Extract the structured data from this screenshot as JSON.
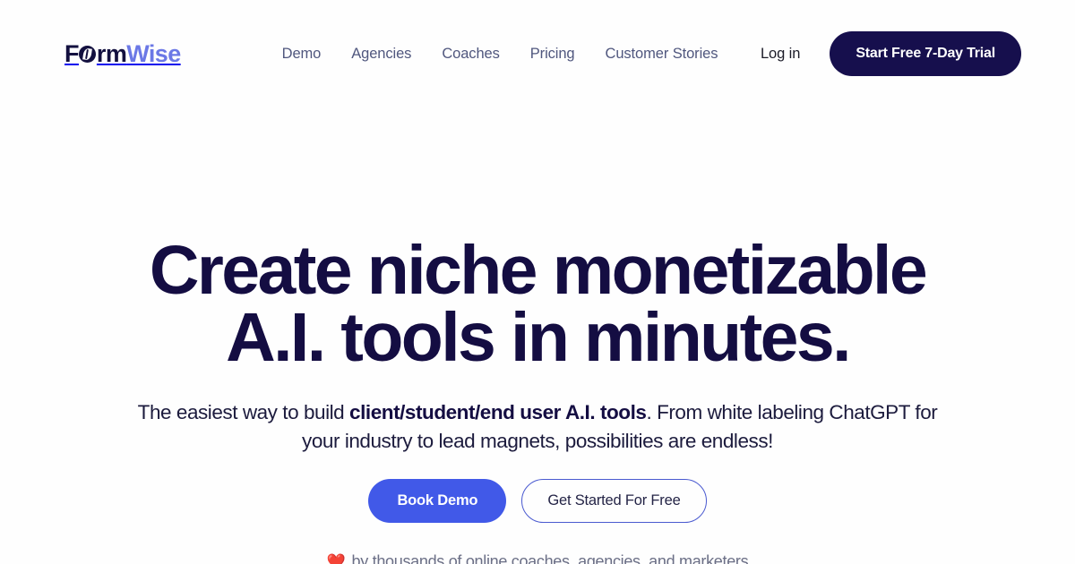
{
  "brand": {
    "part_1": "F",
    "mark_icon": "formwise-leaf-mark-icon",
    "part_2": "rm",
    "part_3": "Wise",
    "color_dark": "#13103f",
    "color_accent": "#6b78e6"
  },
  "nav": {
    "items": [
      {
        "label": "Demo"
      },
      {
        "label": "Agencies"
      },
      {
        "label": "Coaches"
      },
      {
        "label": "Pricing"
      },
      {
        "label": "Customer Stories"
      }
    ]
  },
  "header_actions": {
    "login_label": "Log in",
    "trial_label": "Start Free 7-Day Trial",
    "trial_bg": "#160f4d"
  },
  "hero": {
    "title_line_1": "Create niche monetizable",
    "title_line_2": "A.I. tools in minutes.",
    "title_color": "#140d42",
    "sub_part_1": "The easiest way to build ",
    "sub_bold": "client/student/end user A.I. tools",
    "sub_part_2": ". From white labeling ChatGPT for your industry to lead magnets, possibilities are endless!",
    "cta_primary_label": "Book Demo",
    "cta_primary_bg": "#4159e8",
    "cta_secondary_label": "Get Started For Free",
    "cta_secondary_border": "#4a5ad0",
    "social_proof_icon": "red-heart-icon",
    "social_proof_glyph": "❤️",
    "social_proof_text": "by thousands of online coaches, agencies, and marketers"
  }
}
